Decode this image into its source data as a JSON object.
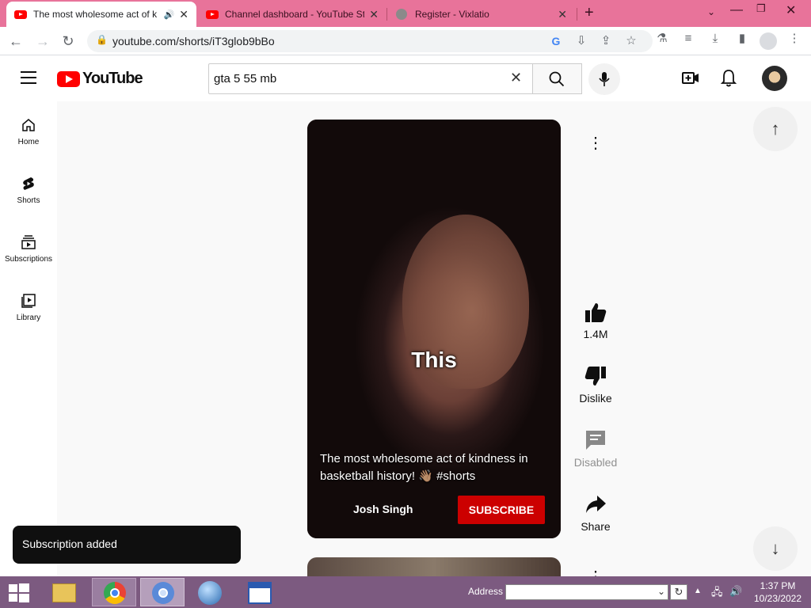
{
  "browser": {
    "tabs": [
      {
        "title": "The most wholesome act of k",
        "active": true
      },
      {
        "title": "Channel dashboard - YouTube St",
        "active": false
      },
      {
        "title": "Register - Vixlatio",
        "active": false
      }
    ],
    "url": "youtube.com/shorts/iT3glob9bBo"
  },
  "youtube": {
    "logo_text": "YouTube",
    "search_value": "gta 5 55 mb",
    "sidebar": [
      {
        "label": "Home",
        "icon": "home-icon"
      },
      {
        "label": "Shorts",
        "icon": "shorts-icon"
      },
      {
        "label": "Subscriptions",
        "icon": "subscriptions-icon"
      },
      {
        "label": "Library",
        "icon": "library-icon"
      }
    ],
    "video": {
      "caption_overlay": "This",
      "title": "The most wholesome act of kindness in basketball history! 👋🏽 #shorts",
      "channel": "Josh Singh",
      "subscribe_label": "SUBSCRIBE"
    },
    "actions": {
      "like_count": "1.4M",
      "dislike_label": "Dislike",
      "comments_label": "Disabled",
      "share_label": "Share"
    },
    "toast": "Subscription added"
  },
  "taskbar": {
    "address_label": "Address",
    "time": "1:37 PM",
    "date": "10/23/2022"
  },
  "colors": {
    "tabstrip": "#e8739a",
    "taskbar": "#7c5a80",
    "subscribe": "#cc0000",
    "brand": "#ff0000"
  }
}
